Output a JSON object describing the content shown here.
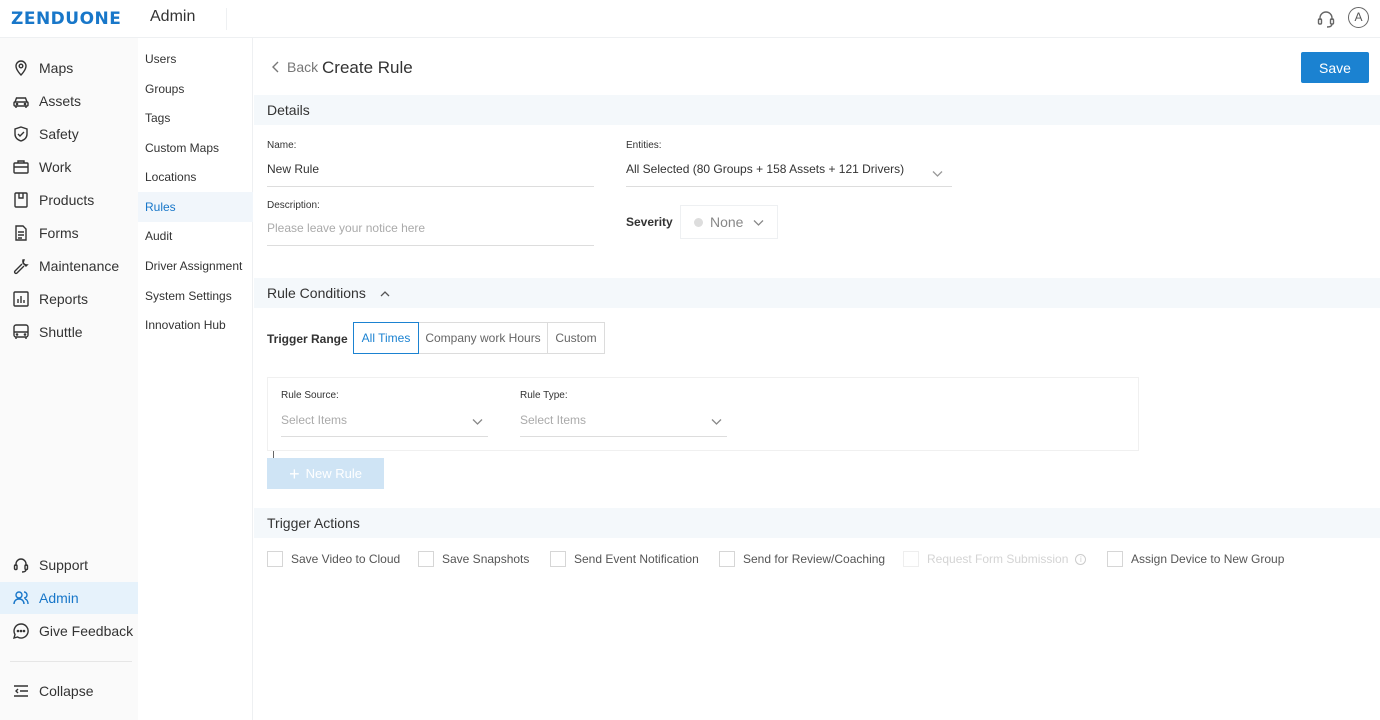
{
  "brand": {
    "logo_main": "ZENDU",
    "logo_accent": "ONE"
  },
  "header": {
    "title": "Admin"
  },
  "main_nav": {
    "items": [
      {
        "label": "Maps",
        "icon": "map-pin-icon"
      },
      {
        "label": "Assets",
        "icon": "car-icon"
      },
      {
        "label": "Safety",
        "icon": "shield-icon"
      },
      {
        "label": "Work",
        "icon": "briefcase-icon"
      },
      {
        "label": "Products",
        "icon": "box-icon"
      },
      {
        "label": "Forms",
        "icon": "document-icon"
      },
      {
        "label": "Maintenance",
        "icon": "wrench-icon"
      },
      {
        "label": "Reports",
        "icon": "bar-chart-icon"
      },
      {
        "label": "Shuttle",
        "icon": "bus-icon"
      }
    ],
    "bottom_items": [
      {
        "label": "Support",
        "icon": "headset-icon"
      },
      {
        "label": "Admin",
        "icon": "users-icon",
        "active": true
      },
      {
        "label": "Give Feedback",
        "icon": "chat-icon"
      }
    ],
    "collapse_label": "Collapse"
  },
  "sub_nav": {
    "items": [
      "Users",
      "Groups",
      "Tags",
      "Custom Maps",
      "Locations",
      "Rules",
      "Audit",
      "Driver Assignment",
      "System Settings",
      "Innovation Hub"
    ],
    "active": "Rules"
  },
  "page": {
    "back_label": "Back",
    "title": "Create Rule",
    "save_label": "Save"
  },
  "details": {
    "section_title": "Details",
    "name_label": "Name:",
    "name_value": "New Rule",
    "entities_label": "Entities:",
    "entities_value": "All Selected (80 Groups + 158 Assets + 121 Drivers)",
    "description_label": "Description:",
    "description_placeholder": "Please leave your notice here",
    "severity_label": "Severity",
    "severity_value": "None"
  },
  "conditions": {
    "section_title": "Rule Conditions",
    "trigger_range_label": "Trigger Range",
    "trigger_options": [
      "All Times",
      "Company work Hours",
      "Custom"
    ],
    "trigger_selected": "All Times",
    "rule_source_label": "Rule Source:",
    "rule_source_placeholder": "Select Items",
    "rule_type_label": "Rule Type:",
    "rule_type_placeholder": "Select Items",
    "new_rule_label": "New Rule"
  },
  "actions": {
    "section_title": "Trigger Actions",
    "items": [
      {
        "label": "Save Video to Cloud",
        "enabled": true
      },
      {
        "label": "Save Snapshots",
        "enabled": true
      },
      {
        "label": "Send Event Notification",
        "enabled": true
      },
      {
        "label": "Send for Review/Coaching",
        "enabled": true
      },
      {
        "label": "Request Form Submission",
        "enabled": false
      },
      {
        "label": "Assign Device to New Group",
        "enabled": true
      }
    ]
  },
  "colors": {
    "accent": "#1b82d1",
    "active_bg": "#e6f2fb",
    "section_bg": "#f4f8fb"
  }
}
